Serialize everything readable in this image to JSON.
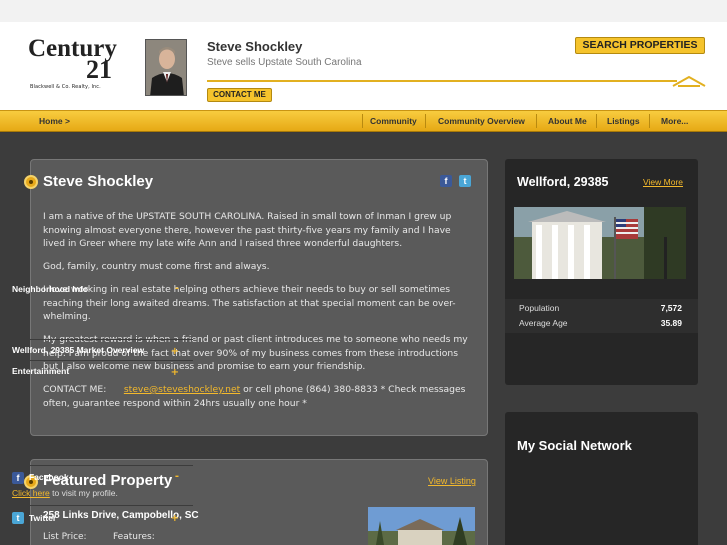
{
  "brand": {
    "logo_word": "Century",
    "logo_number": "21",
    "logo_subtitle": "Blackwell & Co. Realty, Inc."
  },
  "agent": {
    "name": "Steve Shockley",
    "tagline": "Steve sells Upstate South Carolina",
    "contact_label": "CONTACT ME"
  },
  "header": {
    "search_label": "SEARCH PROPERTIES"
  },
  "nav": {
    "home": "Home >",
    "community": "Community",
    "community_overview": "Community Overview",
    "about": "About Me",
    "listings": "Listings",
    "more": "More..."
  },
  "profile": {
    "title": "Steve Shockley",
    "paragraphs": [
      "I am a native of the UPSTATE SOUTH CAROLINA. Raised in small town of Inman I grew up knowing almost everyone there, however the past thirty-five years my family and I have lived in Greer where my late wife Ann and I raised three wonderful daughters.",
      "God, family, country must come first and always.",
      "I love working in real estate helping others achieve their needs to buy or sell sometimes reaching their long awaited dreams. The satisfaction at that special moment can be over-whelming.",
      "My greatest reward is when a friend or past client introduces me to someone who needs my help. I am proud of the fact that over 90% of my business comes from these introductions but I also welcome new business and promise to earn your friendship."
    ],
    "contact_prefix": "CONTACT ME:",
    "contact_email": "steve@steveshockley.net",
    "contact_suffix": "or cell phone (864) 380-8833 * Check messages often, guarantee respond within 24hrs usually one hour *"
  },
  "featured": {
    "title": "Featured Property",
    "view_label": "View Listing",
    "address": "258 Links Drive, Campobello, SC",
    "list_price_label": "List Price:",
    "features_label": "Features:"
  },
  "neighborhood": {
    "title": "Wellford, 29385",
    "view_more": "View More",
    "info_header": "Neighborhood Info",
    "stats": [
      {
        "label": "Population",
        "value": "7,572"
      },
      {
        "label": "Average Age",
        "value": "35.89"
      }
    ],
    "market_overview": "Wellford, 29385 Market Overview",
    "entertainment": "Entertainment"
  },
  "social": {
    "title": "My Social Network",
    "facebook_label": "Facebook",
    "facebook_link": "Click here",
    "facebook_rest": "to visit my profile.",
    "twitter_label": "Twitter"
  },
  "colors": {
    "accent": "#f5c32c",
    "link": "#f3b92c",
    "panel": "#5a5a5a",
    "sidebar": "#262626"
  },
  "icons": {
    "collapse": "-",
    "expand": "+",
    "facebook": "f",
    "twitter": "t"
  }
}
